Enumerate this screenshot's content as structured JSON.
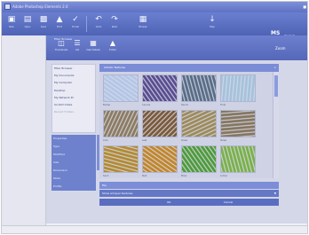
{
  "window": {
    "title": "Adobe Photoshop Elements 2.0"
  },
  "toolbar": {
    "items": [
      {
        "icon": "new-icon",
        "label": "New"
      },
      {
        "icon": "open-icon",
        "label": "Open"
      },
      {
        "icon": "save-icon",
        "label": "Save"
      },
      {
        "icon": "print-icon",
        "label": "Print"
      },
      {
        "icon": "email-icon",
        "label": "E-mail"
      },
      {
        "icon": "undo-icon",
        "label": "Undo"
      },
      {
        "icon": "redo-icon",
        "label": "Redo"
      },
      {
        "icon": "browse-icon",
        "label": "Browse"
      },
      {
        "icon": "help-icon",
        "label": "Help"
      }
    ],
    "badge": "MS",
    "badge_sub": "Zoom %"
  },
  "panel": {
    "label": "Filter Browser",
    "buttons": [
      {
        "icon": "thumbnail-icon",
        "label": "Thumbnails"
      },
      {
        "icon": "list-icon",
        "label": "List"
      },
      {
        "icon": "view-icon",
        "label": "View Details"
      },
      {
        "icon": "folder-icon",
        "label": "Folder"
      }
    ],
    "right_label": "Zoom"
  },
  "nav": {
    "items": [
      "Filter Browser",
      "My Documents",
      "My Computer",
      "Desktop",
      "My Network Pl.",
      "Scratch Disks",
      "Recent Folders"
    ],
    "muted_index": 6
  },
  "props": {
    "rows": [
      "Properties",
      "Type",
      "Modified",
      "Size",
      "Dimension",
      "Mode",
      "Profile"
    ]
  },
  "grid": {
    "header": "Artistic Textures",
    "items": [
      {
        "caption": "Burlap",
        "color": "#b3c6e6"
      },
      {
        "caption": "Canvas",
        "color": "#584d8f"
      },
      {
        "caption": "Denim",
        "color": "#586d86"
      },
      {
        "caption": "Frost",
        "color": "#a5c2db"
      },
      {
        "caption": "Cork",
        "color": "#8b7b60"
      },
      {
        "caption": "Leaf",
        "color": "#7a5a3a"
      },
      {
        "caption": "Grass",
        "color": "#9c8a5c"
      },
      {
        "caption": "Straw",
        "color": "#857660"
      },
      {
        "caption": "Sand",
        "color": "#b18a35"
      },
      {
        "caption": "Rust",
        "color": "#c0862a"
      },
      {
        "caption": "Moss",
        "color": "#4e9a3a"
      },
      {
        "caption": "Lichen",
        "color": "#7ab04a"
      }
    ]
  },
  "bottom": {
    "row1": "File",
    "row2": "Show all layer textures",
    "btn_ok": "OK",
    "btn_cancel": "Cancel"
  }
}
